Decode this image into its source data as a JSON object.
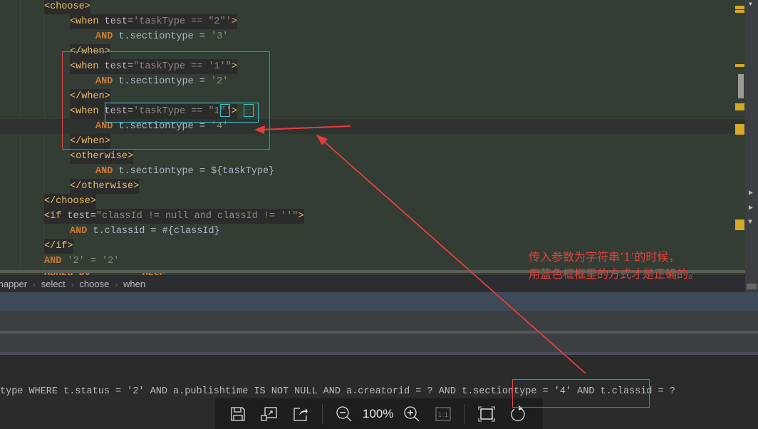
{
  "editor": {
    "lines": [
      {
        "id": "choose-open",
        "parts": [
          [
            "tag",
            "<choose>"
          ]
        ],
        "indent": 62,
        "bg": true
      },
      {
        "id": "when-1-open",
        "parts": [
          [
            "tag",
            "<when "
          ],
          [
            "attr",
            "test="
          ],
          [
            "strg",
            "'taskType == \"2\"'"
          ],
          [
            "tag",
            ">"
          ]
        ],
        "indent": 98,
        "bg": true
      },
      {
        "id": "and-1",
        "parts": [
          [
            "kw",
            "AND"
          ],
          [
            "plain",
            " t.sectiontype = "
          ],
          [
            "strg",
            "'3'"
          ]
        ],
        "indent": 134
      },
      {
        "id": "when-1-close",
        "parts": [
          [
            "tag",
            "</when>"
          ]
        ],
        "indent": 98,
        "bg": true
      },
      {
        "id": "when-2-open",
        "parts": [
          [
            "tag",
            "<when "
          ],
          [
            "attr",
            "test="
          ],
          [
            "strg",
            "\"taskType == '1'\""
          ],
          [
            "tag",
            ">"
          ]
        ],
        "indent": 98,
        "bg": true
      },
      {
        "id": "and-2",
        "parts": [
          [
            "kw",
            "AND"
          ],
          [
            "plain",
            " t.sectiontype = "
          ],
          [
            "strg",
            "'2'"
          ]
        ],
        "indent": 134
      },
      {
        "id": "when-2-close",
        "parts": [
          [
            "tag",
            "</when>"
          ]
        ],
        "indent": 98,
        "bg": true
      },
      {
        "id": "when-3-open",
        "parts": [
          [
            "tag",
            "<when "
          ],
          [
            "attr",
            "test="
          ],
          [
            "strg",
            "'taskType == \"1\"'"
          ],
          [
            "tag",
            ">"
          ]
        ],
        "indent": 98,
        "bg": true
      },
      {
        "id": "and-3",
        "parts": [
          [
            "kw",
            "AND"
          ],
          [
            "plain",
            " t.sectiontype = "
          ],
          [
            "strg",
            "'4'"
          ]
        ],
        "indent": 134,
        "current": true
      },
      {
        "id": "when-3-close",
        "parts": [
          [
            "tag",
            "</when>"
          ]
        ],
        "indent": 98,
        "bg": true
      },
      {
        "id": "otherwise-open",
        "parts": [
          [
            "tag",
            "<otherwise>"
          ]
        ],
        "indent": 98,
        "bg": true
      },
      {
        "id": "and-4",
        "parts": [
          [
            "kw",
            "AND"
          ],
          [
            "plain",
            " t.sectiontype = ${taskType}"
          ]
        ],
        "indent": 134
      },
      {
        "id": "otherwise-close",
        "parts": [
          [
            "tag",
            "</otherwise>"
          ]
        ],
        "indent": 98,
        "bg": true
      },
      {
        "id": "choose-close",
        "parts": [
          [
            "tag",
            "</choose>"
          ]
        ],
        "indent": 62,
        "bg": true
      },
      {
        "id": "if-open",
        "parts": [
          [
            "tag",
            "<if "
          ],
          [
            "attr",
            "test="
          ],
          [
            "strg",
            "\"classId != null and classId != ''\""
          ],
          [
            "tag",
            ">"
          ]
        ],
        "indent": 62,
        "bg": true
      },
      {
        "id": "and-5",
        "parts": [
          [
            "kw",
            "AND"
          ],
          [
            "plain",
            " t.classid = #{classId}"
          ]
        ],
        "indent": 98
      },
      {
        "id": "if-close",
        "parts": [
          [
            "tag",
            "</if>"
          ]
        ],
        "indent": 62,
        "bg": true
      },
      {
        "id": "and-6",
        "parts": [
          [
            "kw",
            "AND"
          ],
          [
            "strg",
            " '2' = '2'"
          ]
        ],
        "indent": 62
      },
      {
        "id": "order-by",
        "parts": [
          [
            "kw",
            "ORDER BY"
          ],
          [
            "plain",
            "   ...   "
          ],
          [
            "kw",
            "DESC"
          ]
        ],
        "indent": 62
      }
    ]
  },
  "breadcrumb": [
    "mapper",
    "select",
    "choose",
    "when"
  ],
  "console": {
    "sql_line": "type WHERE t.status = '2' AND a.publishtime IS NOT NULL AND a.creatorid = ? AND t.sectiontype = '4' AND t.classid = ?"
  },
  "annotation": {
    "note_line1": "传入参数为字符串‘1’的时候，",
    "note_line2": "用蓝色框框里的方式才是正确的。",
    "red_color": "#e04848",
    "cyan_color": "#3ec1c9"
  },
  "viewer_toolbar": {
    "zoom_level": "100%",
    "buttons": [
      "save",
      "resize",
      "share",
      "zoom-out",
      "zoom-in",
      "actual-size",
      "fit-screen",
      "rotate"
    ]
  }
}
